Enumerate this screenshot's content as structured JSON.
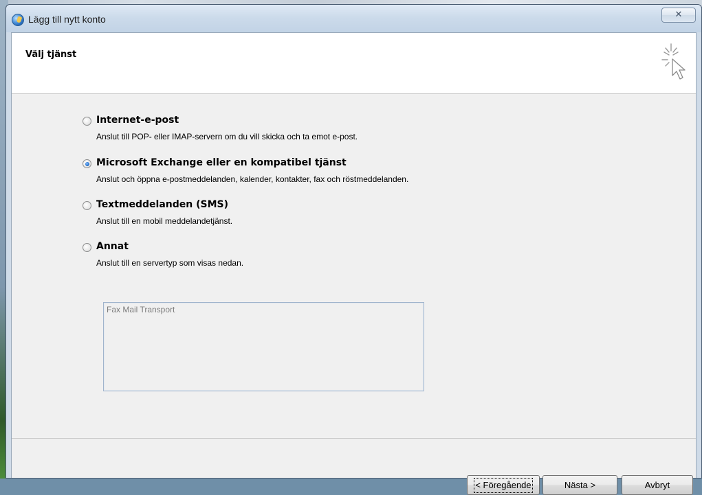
{
  "window": {
    "title": "Lägg till nytt konto",
    "close_glyph": "✕"
  },
  "header": {
    "title": "Välj tjänst",
    "icon": "cursor-sparkle-icon"
  },
  "options": [
    {
      "label": "Internet-e-post",
      "description": "Anslut till POP- eller IMAP-servern om du vill skicka och ta emot e-post.",
      "selected": false
    },
    {
      "label": "Microsoft Exchange eller en kompatibel tjänst",
      "description": "Anslut och öppna e-postmeddelanden, kalender, kontakter, fax och röstmeddelanden.",
      "selected": true
    },
    {
      "label": "Textmeddelanden (SMS)",
      "description": "Anslut till en mobil meddelandetjänst.",
      "selected": false
    },
    {
      "label": "Annat",
      "description": "Anslut till en servertyp som visas nedan.",
      "selected": false
    }
  ],
  "server_list": {
    "items": [
      "Fax Mail Transport"
    ],
    "enabled": false
  },
  "buttons": {
    "back": "< Föregående",
    "next": "Nästa >",
    "cancel": "Avbryt"
  }
}
